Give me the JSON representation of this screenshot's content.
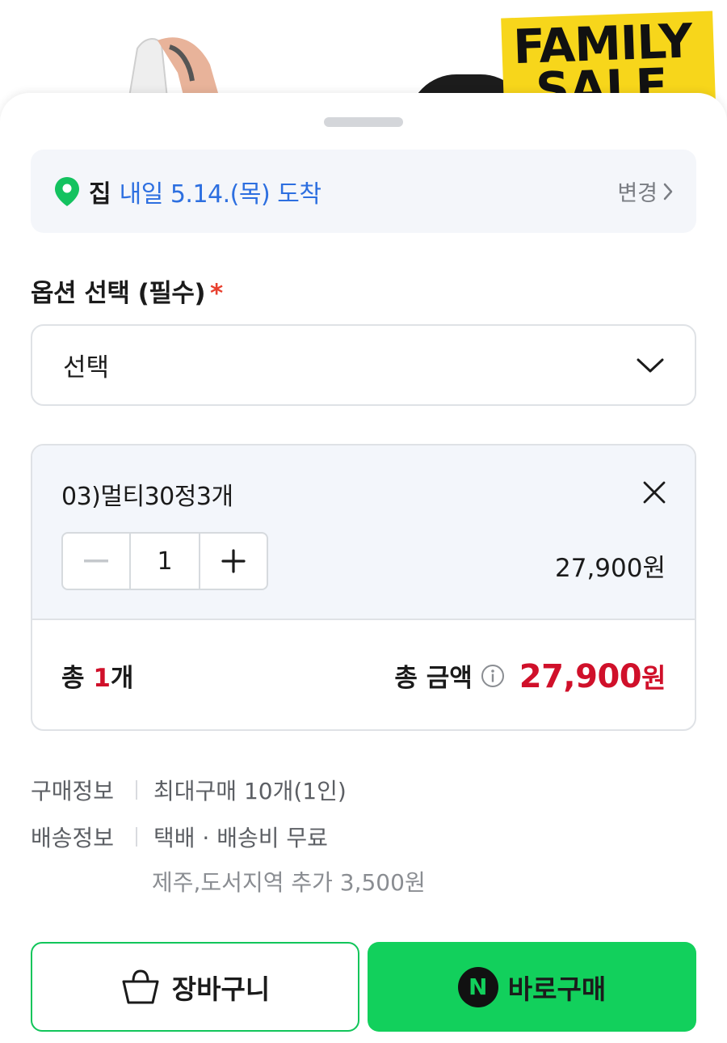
{
  "hero": {
    "sale_line1": "FAMILY",
    "sale_line2": "SALE"
  },
  "delivery": {
    "icon": "location-pin-icon",
    "place": "집",
    "arrival": "내일 5.14.(목) 도착",
    "change_label": "변경"
  },
  "option": {
    "title": "옵션 선택 (필수)",
    "required_mark": "*",
    "select_value": "선택"
  },
  "cart_item": {
    "name": "03)멀티30정3개",
    "quantity": "1",
    "price": "27,900원"
  },
  "total": {
    "count_prefix": "총 ",
    "count": "1",
    "count_suffix": "개",
    "amount_label": "총 금액",
    "amount": "27,900",
    "amount_unit": "원"
  },
  "info": {
    "purchase_key": "구매정보",
    "purchase_value": "최대구매 10개(1인)",
    "shipping_key": "배송정보",
    "shipping_value": "택배 · 배송비 무료",
    "shipping_extra": "제주,도서지역 추가 3,500원"
  },
  "buttons": {
    "cart_label": "장바구니",
    "buy_badge": "N",
    "buy_label": "바로구매"
  },
  "colors": {
    "accent_blue": "#2d6fe0",
    "price_red": "#d0102a",
    "naver_green": "#12d05c",
    "pin_green": "#14c25f"
  }
}
